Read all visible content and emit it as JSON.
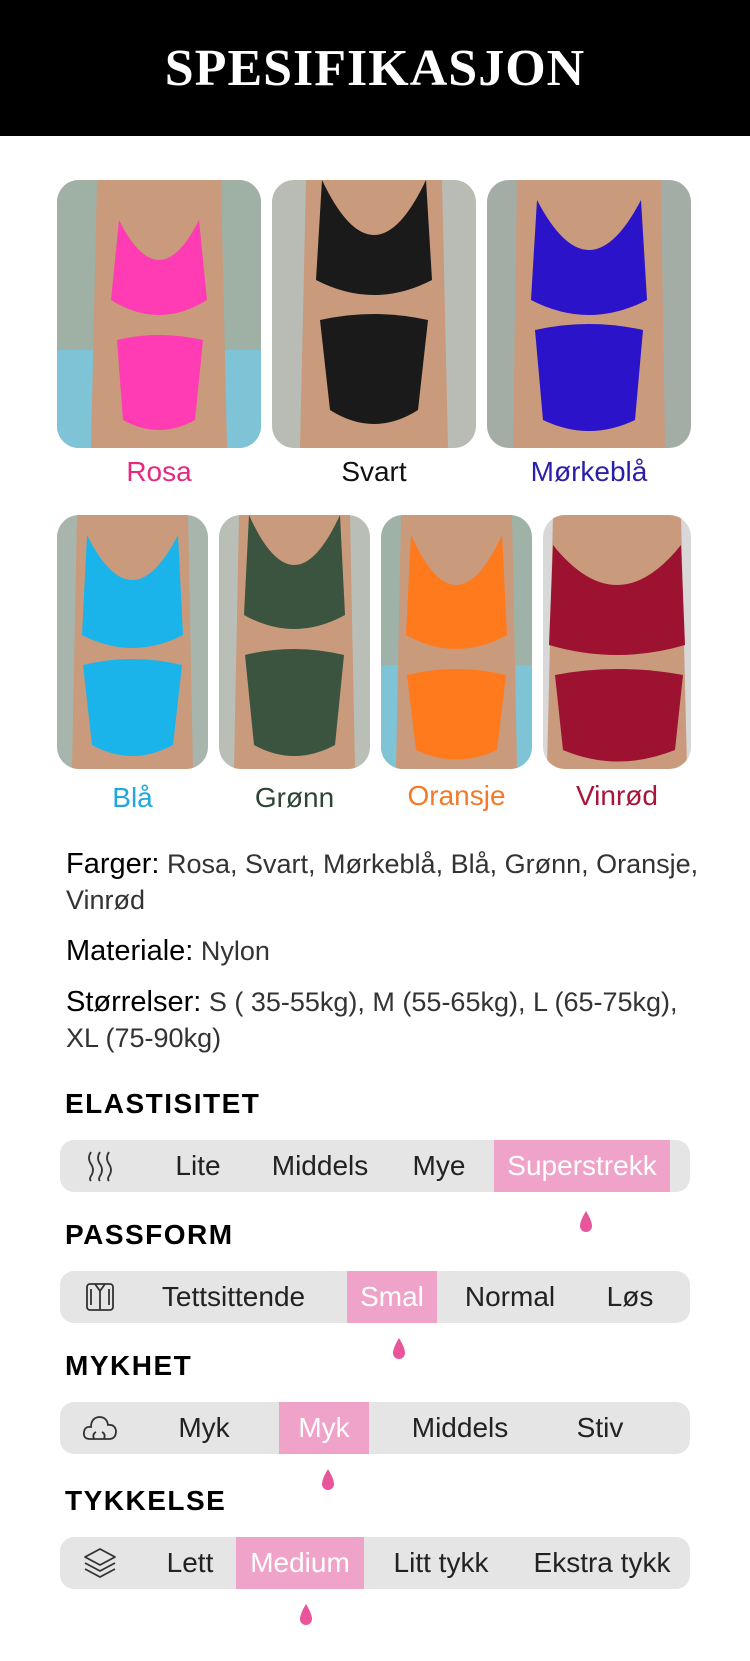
{
  "header": {
    "title": "SPESIFIKASJON"
  },
  "colors": {
    "accent_pink": "#f0a3c8",
    "scale_bg": "#e5e5e5",
    "rosa": "#e8287c",
    "svart": "#111111",
    "morkebla": "#2a1fa8",
    "bla": "#1fa8e0",
    "gronn": "#2f4533",
    "oransje": "#f27a2a",
    "vinrod": "#a8153a"
  },
  "swatches": [
    {
      "label": "Rosa",
      "color": "#e8287c",
      "fabric": "#ff3cb4"
    },
    {
      "label": "Svart",
      "color": "#111111",
      "fabric": "#1a1a1a"
    },
    {
      "label": "Mørkeblå",
      "color": "#2a1fa8",
      "fabric": "#2a13c8"
    },
    {
      "label": "Blå",
      "color": "#1fa8e0",
      "fabric": "#1bb4ea"
    },
    {
      "label": "Grønn",
      "color": "#2f4533",
      "fabric": "#3a5440"
    },
    {
      "label": "Oransje",
      "color": "#f27a2a",
      "fabric": "#ff7a1c"
    },
    {
      "label": "Vinrød",
      "color": "#a8153a",
      "fabric": "#9c1230"
    }
  ],
  "specs": {
    "farger_label": "Farger:",
    "farger_value": "Rosa, Svart, Mørkeblå, Blå, Grønn, Oransje, Vinrød",
    "materiale_label": "Materiale:",
    "materiale_value": "Nylon",
    "storrelser_label": "Størrelser:",
    "storrelser_value": "S ( 35-55kg), M (55-65kg), L  (65-75kg), XL (75-90kg)"
  },
  "scales": {
    "elastisitet": {
      "title": "ELASTISITET",
      "icon": "stretch-waves-icon",
      "options": [
        "Lite",
        "Middels",
        "Mye",
        "Superstrekk"
      ],
      "selected": "Superstrekk"
    },
    "passform": {
      "title": "PASSFORM",
      "icon": "shirt-icon",
      "options": [
        "Tettsittende",
        "Smal",
        "Normal",
        "Løs"
      ],
      "selected": "Smal"
    },
    "mykhet": {
      "title": "MYKHET",
      "icon": "cloud-icon",
      "options": [
        "Myk",
        "Myk",
        "Middels",
        "Stiv"
      ],
      "selected_index": 1
    },
    "tykkelse": {
      "title": "TYKKELSE",
      "icon": "layers-icon",
      "options": [
        "Lett",
        "Medium",
        "Litt tykk",
        "Ekstra tykk"
      ],
      "selected": "Medium"
    }
  }
}
